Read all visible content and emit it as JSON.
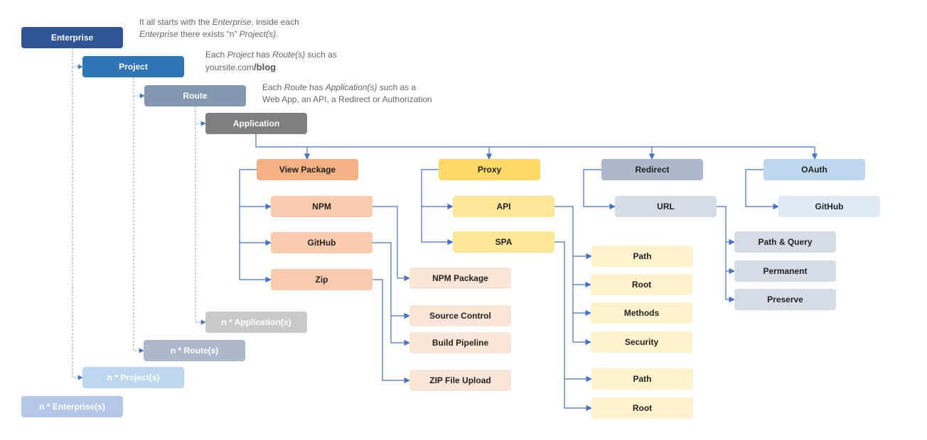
{
  "notes": {
    "enterprise": {
      "line1_pre": "It all starts with the ",
      "line1_em": "Enterprise",
      "line1_post": ", inside each",
      "line2_em": "Enterprise",
      "line2_mid": " there exists “n” ",
      "line2_em2": "Project(s)",
      "line2_post": "."
    },
    "project": {
      "line1_pre": "Each ",
      "line1_em": "Project",
      "line1_mid": " has ",
      "line1_em2": "Route(s)",
      "line1_post": " such as",
      "line2_pre": "yoursite.com",
      "line2_bold": "/blog"
    },
    "route": {
      "line1_pre": "Each ",
      "line1_em": "Route",
      "line1_mid": " has ",
      "line1_em2": "Application(s)",
      "line1_post": " such as a",
      "line2": "Web App, an API, a Redirect or Authorization"
    }
  },
  "colors": {
    "wire": "#4472c4",
    "wire_dashed": "#8eaadb"
  },
  "nodes": {
    "enterprise": {
      "label": "Enterprise",
      "bg": "#2f5597",
      "fg": "#ffffff"
    },
    "project": {
      "label": "Project",
      "bg": "#2e75b6",
      "fg": "#ffffff"
    },
    "route": {
      "label": "Route",
      "bg": "#8497b0",
      "fg": "#ffffff"
    },
    "application": {
      "label": "Application",
      "bg": "#7f7f7f",
      "fg": "#ffffff"
    },
    "n_application": {
      "label": "n * Application(s)",
      "bg": "#c9c9c9",
      "fg": "#ffffff"
    },
    "n_route": {
      "label": "n * Route(s)",
      "bg": "#adb9ca",
      "fg": "#ffffff"
    },
    "n_project": {
      "label": "n * Project(s)",
      "bg": "#bdd7ee",
      "fg": "#ffffff"
    },
    "n_enterprise": {
      "label": "n * Enterprise(s)",
      "bg": "#b4c7e7",
      "fg": "#ffffff"
    },
    "view_package": {
      "label": "View Package",
      "bg": "#f4b183",
      "fg": "#222222"
    },
    "npm": {
      "label": "NPM",
      "bg": "#f8cbad",
      "fg": "#222222"
    },
    "github_vp": {
      "label": "GitHub",
      "bg": "#f8cbad",
      "fg": "#222222"
    },
    "zip": {
      "label": "Zip",
      "bg": "#f8cbad",
      "fg": "#222222"
    },
    "npm_package": {
      "label": "NPM Package",
      "bg": "#fbe5d6",
      "fg": "#222222"
    },
    "source_control": {
      "label": "Source Control",
      "bg": "#fbe5d6",
      "fg": "#222222"
    },
    "build_pipeline": {
      "label": "Build Pipeline",
      "bg": "#fbe5d6",
      "fg": "#222222"
    },
    "zip_upload": {
      "label": "ZIP File Upload",
      "bg": "#fbe5d6",
      "fg": "#222222"
    },
    "proxy": {
      "label": "Proxy",
      "bg": "#ffd966",
      "fg": "#222222"
    },
    "api": {
      "label": "API",
      "bg": "#ffe699",
      "fg": "#222222"
    },
    "spa": {
      "label": "SPA",
      "bg": "#ffe699",
      "fg": "#222222"
    },
    "api_path": {
      "label": "Path",
      "bg": "#fff2cc",
      "fg": "#222222"
    },
    "api_root": {
      "label": "Root",
      "bg": "#fff2cc",
      "fg": "#222222"
    },
    "api_methods": {
      "label": "Methods",
      "bg": "#fff2cc",
      "fg": "#222222"
    },
    "api_security": {
      "label": "Security",
      "bg": "#fff2cc",
      "fg": "#222222"
    },
    "spa_path": {
      "label": "Path",
      "bg": "#fff2cc",
      "fg": "#222222"
    },
    "spa_root": {
      "label": "Root",
      "bg": "#fff2cc",
      "fg": "#222222"
    },
    "redirect": {
      "label": "Redirect",
      "bg": "#adb9ca",
      "fg": "#222222"
    },
    "url": {
      "label": "URL",
      "bg": "#d6dce5",
      "fg": "#222222"
    },
    "path_query": {
      "label": "Path & Query",
      "bg": "#d6dce5",
      "fg": "#222222"
    },
    "permanent": {
      "label": "Permanent",
      "bg": "#d6dce5",
      "fg": "#222222"
    },
    "preserve": {
      "label": "Preserve",
      "bg": "#d6dce5",
      "fg": "#222222"
    },
    "oauth": {
      "label": "OAuth",
      "bg": "#bdd7ee",
      "fg": "#222222"
    },
    "github_oauth": {
      "label": "GitHub",
      "bg": "#deebf7",
      "fg": "#222222"
    }
  }
}
